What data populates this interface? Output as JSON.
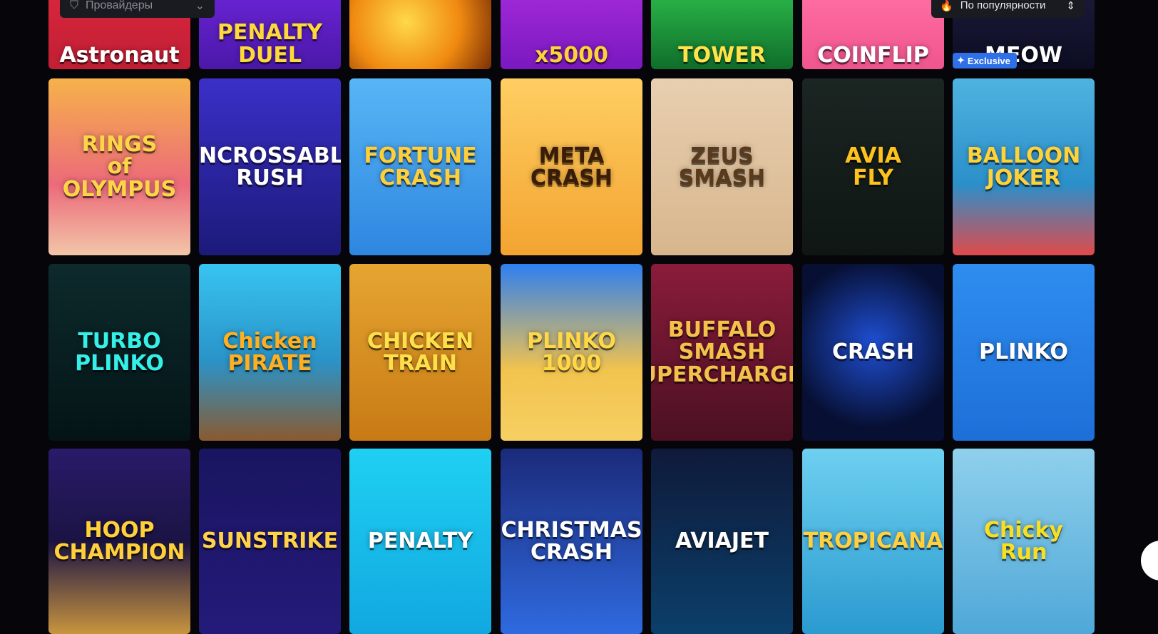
{
  "filters": {
    "providers_placeholder": "Провайдеры",
    "sort_label": "По популярности",
    "filter_icon": "filter-icon",
    "chevron_icon": "chevron-down-icon",
    "flame_icon": "flame-icon",
    "sort_icon": "sort-updown-icon"
  },
  "exclusive_badge": "Exclusive",
  "games": {
    "row0": [
      {
        "title": "Astronaut",
        "bg": "linear-gradient(180deg,#d8263c,#c21f35)",
        "color": "#ffffff"
      },
      {
        "title": "PENALTY\nDUEL",
        "bg": "linear-gradient(180deg,#6a24d6,#4b18a8)",
        "color": "#ffd93a"
      },
      {
        "title": "",
        "bg": "radial-gradient(circle at 40% 40%,#ffd84a,#f08a10 55%,#7a2e06)",
        "color": "#ffffff"
      },
      {
        "title": "x5000",
        "bg": "linear-gradient(180deg,#a22ad8,#7a18c0)",
        "color": "#ffd23a"
      },
      {
        "title": "TOWER",
        "bg": "linear-gradient(180deg,#2cb84a,#0f6e2a)",
        "color": "#ffe34a"
      },
      {
        "title": "COINFLIP",
        "bg": "linear-gradient(180deg,#ff6fa2,#f0558e)",
        "color": "#ffffff"
      },
      {
        "title": "MEOW",
        "bg": "linear-gradient(180deg,#1b1b3a,#0c0c22)",
        "color": "#ffffff"
      }
    ],
    "row1": [
      {
        "title": "RINGS\nof\nOLYMPUS",
        "bg": "linear-gradient(180deg,#f6b24a,#ec6a7a 60%,#f2c6a8)",
        "color": "#ffd548"
      },
      {
        "title": "UNCROSSABLE\nRUSH",
        "bg": "linear-gradient(180deg,#3b2fc8,#1c1a7a)",
        "color": "#ffffff"
      },
      {
        "title": "FORTUNE\nCRASH",
        "bg": "linear-gradient(180deg,#57b6f5,#2f86e0)",
        "color": "#ffcf3a"
      },
      {
        "title": "META CRASH",
        "bg": "linear-gradient(180deg,#ffce62,#f3a431)",
        "color": "#3a1c08"
      },
      {
        "title": "ZEUS SMASH",
        "bg": "linear-gradient(180deg,#e8cfb0,#d7b68d)",
        "color": "#5a3a1a"
      },
      {
        "title": "AVIA\nFLY",
        "bg": "linear-gradient(180deg,#1b2522,#0f1614)",
        "color": "#ffc21c"
      },
      {
        "title": "BALLOON\nJOKER",
        "bg": "linear-gradient(180deg,#4fb3e0,#2b8fca 60%,#e04a4a)",
        "color": "#ffd23a"
      }
    ],
    "row2": [
      {
        "title": "TURBO\nPLINKO",
        "bg": "linear-gradient(180deg,#0d2a2c,#041416)",
        "color": "#34f0e8"
      },
      {
        "title": "Chicken\nPIRATE",
        "bg": "linear-gradient(180deg,#37c4f0,#2a93c8 55%,#8a5a30)",
        "color": "#ffb020"
      },
      {
        "title": "CHICKEN\nTRAIN",
        "bg": "linear-gradient(180deg,#e6a531,#c87a14)",
        "color": "#ffe04a"
      },
      {
        "title": "PLINKO\n1000",
        "bg": "linear-gradient(180deg,#2e7ff0,#f2c34e 60%,#f6cf63)",
        "color": "#ffd84a"
      },
      {
        "title": "BUFFALO SMASH\nSUPERCHARGED",
        "bg": "linear-gradient(180deg,#8a1c3a,#4b1022)",
        "color": "#f4c24a"
      },
      {
        "title": "CRASH",
        "bg": "radial-gradient(circle at 50% 45%,#1f4fd4,#071033 70%)",
        "color": "#ffffff"
      },
      {
        "title": "PLINKO",
        "bg": "linear-gradient(180deg,#2f8df0,#1d6fd8)",
        "color": "#ffffff"
      }
    ],
    "row3": [
      {
        "title": "HOOP\nCHAMPION",
        "bg": "linear-gradient(180deg,#2a1a6a,#1b1444 50%,#c8943e)",
        "color": "#ffd03a"
      },
      {
        "title": "SUNSTRIKE",
        "bg": "linear-gradient(180deg,#1a1560,#241a7a)",
        "color": "#ffd24a"
      },
      {
        "title": "PENALTY",
        "bg": "linear-gradient(180deg,#1fd0f2,#11a8e0)",
        "color": "#ffffff"
      },
      {
        "title": "CHRISTMAS\nCRASH",
        "bg": "linear-gradient(180deg,#1b2a7a,#2f6ae0)",
        "color": "#ffffff"
      },
      {
        "title": "AVIAJET",
        "bg": "linear-gradient(180deg,#0f1a3a,#0b3f6a)",
        "color": "#ffffff"
      },
      {
        "title": "TROPICANA",
        "bg": "linear-gradient(180deg,#6ed0f0,#2a9ad0)",
        "color": "#ffd040"
      },
      {
        "title": "Chicky\nRun",
        "bg": "linear-gradient(180deg,#8fd0ec,#4fa8d8)",
        "color": "#f8e020"
      }
    ]
  }
}
